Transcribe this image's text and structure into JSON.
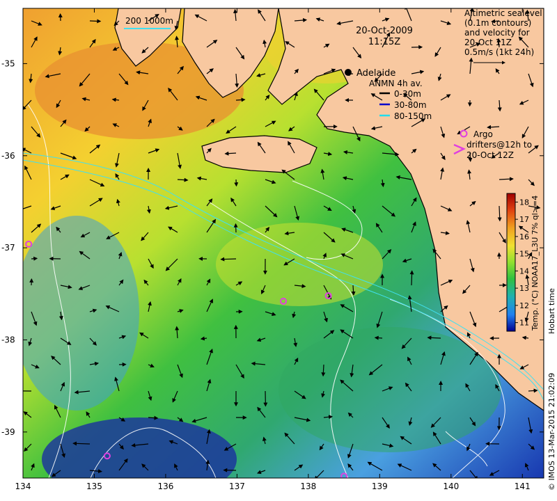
{
  "map": {
    "date": "20-Oct-2009",
    "time": "11:15Z",
    "place_label": "Adelaide",
    "scale_label": "200  1000m",
    "sealevel_note": [
      "Altimetric sealevel",
      "(0.1m contours)",
      "and velocity for",
      "20-Oct 11Z",
      "0.5m/s (1kt 24h)"
    ],
    "anmn_title": "ANMN 4h av.",
    "anmn_legend": [
      {
        "label": "0-30m",
        "color": "#000000"
      },
      {
        "label": "30-80m",
        "color": "#0000cc"
      },
      {
        "label": "80-150m",
        "color": "#22ddee"
      }
    ],
    "argo_label": "Argo",
    "drifter_label": [
      "drifters@12h to",
      "20-Oct 12Z"
    ],
    "x_ticks": [
      "134",
      "135",
      "136",
      "137",
      "138",
      "139",
      "140",
      "141"
    ],
    "y_ticks": [
      "-35",
      "-36",
      "-37",
      "-38",
      "-39"
    ],
    "colorbar_ticks": [
      "18",
      "17",
      "16",
      "15",
      "14",
      "13",
      "12",
      "11"
    ],
    "colorbar_label": "Temp. (°C) NOAA17_L3U 7% ql>=4",
    "hobart_label": "Hobart time",
    "credit": "© IMOS 13-Mar-2015 21:02:09",
    "colors": {
      "land": "#f8c8a0",
      "argo": "#e040e0",
      "warm": "#e88a28",
      "cool": "#2a5ad8"
    },
    "lon_range": [
      134,
      141.3
    ],
    "lat_range": [
      -39.5,
      -34.4
    ],
    "sst_range": [
      10.5,
      18.5
    ],
    "argo_floats": [
      {
        "lon": 137.65,
        "lat": -37.58
      },
      {
        "lon": 138.28,
        "lat": -37.52
      },
      {
        "lon": 135.18,
        "lat": -39.26
      },
      {
        "lon": 138.5,
        "lat": -39.48
      },
      {
        "lon": 134.08,
        "lat": -36.96
      }
    ]
  }
}
